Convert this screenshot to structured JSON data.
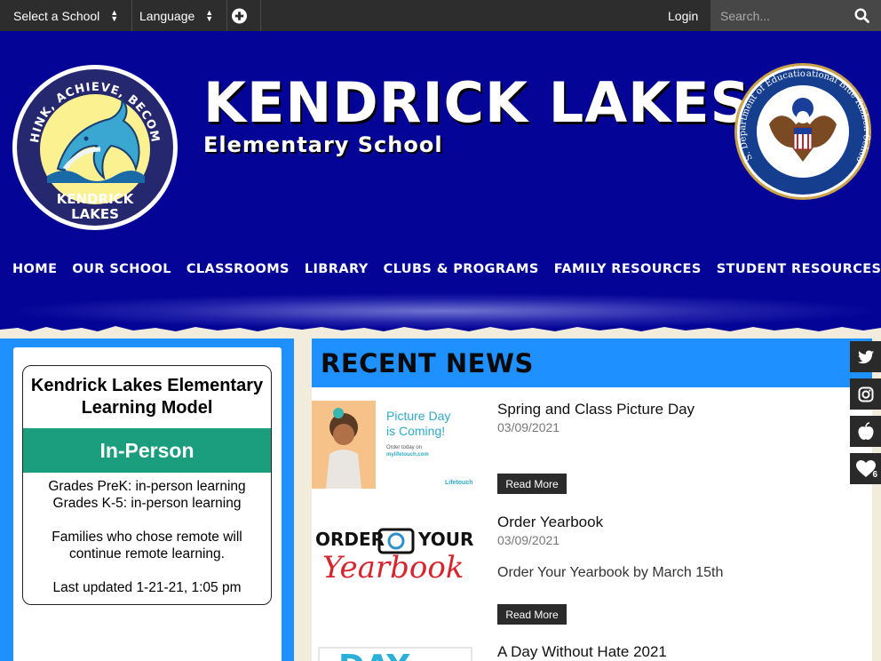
{
  "topbar": {
    "select_school": "Select a School",
    "language": "Language",
    "login": "Login",
    "search_placeholder": "Search..."
  },
  "header": {
    "logo_text_top": "THINK, ACHIEVE, BECOME",
    "logo_text_bottom_1": "KENDRICK",
    "logo_text_bottom_2": "LAKES",
    "title": "KENDRICK LAKES",
    "subtitle": "Elementary School",
    "seal_text_left": "U.S. Department of Education",
    "seal_text_right": "National Blue Ribbon Schools"
  },
  "nav": {
    "items": [
      "HOME",
      "OUR SCHOOL",
      "CLASSROOMS",
      "LIBRARY",
      "CLUBS & PROGRAMS",
      "FAMILY RESOURCES",
      "STUDENT RESOURCES"
    ]
  },
  "sidebar": {
    "model_title_1": "Kendrick Lakes Elementary",
    "model_title_2": "Learning Model",
    "model_status": "In-Person",
    "line1": "Grades PreK: in-person learning",
    "line2": "Grades K-5: in-person learning",
    "line3": "Families who chose remote will",
    "line4": "continue remote learning.",
    "updated": "Last updated 1-21-21, 1:05 pm"
  },
  "news": {
    "heading": "RECENT NEWS",
    "items": [
      {
        "title": "Spring and Class Picture Day",
        "date": "03/09/2021",
        "excerpt": "",
        "read_more": "Read More",
        "thumb": {
          "line1": "Picture Day",
          "line2": "is Coming!",
          "line3": "Order today on",
          "line4": "mylifetouch.com",
          "brand": "Lifetouch"
        }
      },
      {
        "title": "Order Yearbook",
        "date": "03/09/2021",
        "excerpt": "Order Your Yearbook by March 15th",
        "read_more": "Read More",
        "thumb": {
          "word1": "ORDER",
          "word2": "YOUR",
          "word3": "Yearbook"
        }
      },
      {
        "title": "A Day Without Hate 2021",
        "thumb": {
          "text": "DAY"
        }
      }
    ]
  },
  "social": {
    "heart_count": "6"
  },
  "colors": {
    "header_blue": "#040496",
    "accent_blue": "#1e90ff",
    "status_green": "#1a9e7d",
    "topbar": "#2d2d2d",
    "page_bg": "#f2ecdd"
  }
}
